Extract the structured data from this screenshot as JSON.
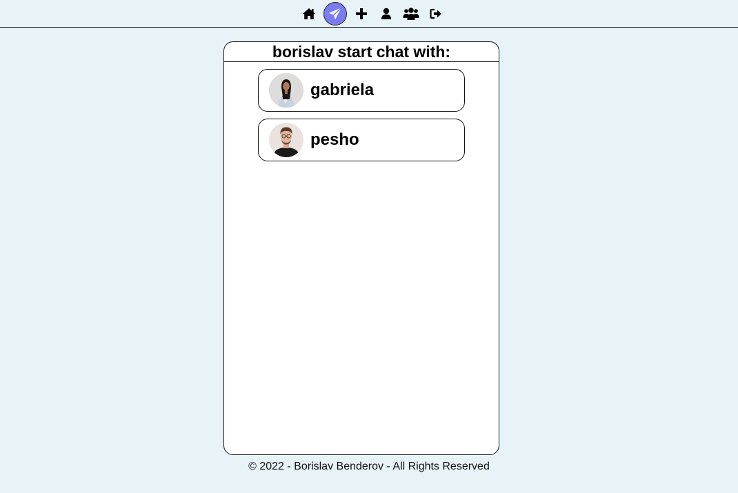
{
  "nav": {
    "items": [
      {
        "icon": "home-icon",
        "active": false
      },
      {
        "icon": "paper-plane-icon",
        "active": true
      },
      {
        "icon": "plus-icon",
        "active": false
      },
      {
        "icon": "user-icon",
        "active": false
      },
      {
        "icon": "users-icon",
        "active": false
      },
      {
        "icon": "sign-out-icon",
        "active": false
      }
    ],
    "active_color": "#7b7cf2"
  },
  "chat": {
    "title": "borislav start chat with:",
    "contacts": [
      {
        "name": "gabriela",
        "avatar": "gabriela-avatar"
      },
      {
        "name": "pesho",
        "avatar": "pesho-avatar"
      }
    ]
  },
  "footer": {
    "text": "© 2022 - Borislav Benderov - All Rights Reserved"
  },
  "colors": {
    "background": "#e8f3f8",
    "card": "#ffffff",
    "border": "#111111"
  }
}
